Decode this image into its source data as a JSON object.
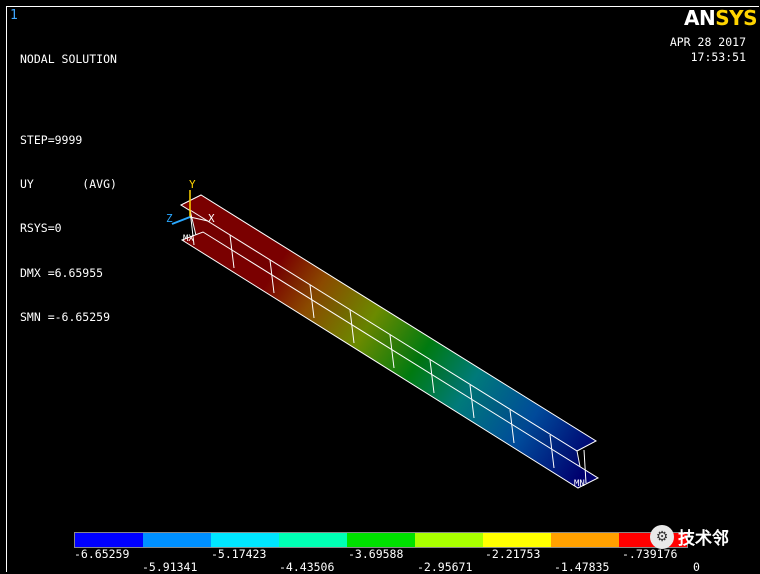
{
  "window_number": "1",
  "solution": {
    "title": "NODAL SOLUTION",
    "step": "STEP=9999",
    "item": "UY       (AVG)",
    "rsys": "RSYS=0",
    "dmx": "DMX =6.65955",
    "smn": "SMN =-6.65259"
  },
  "logo": {
    "part1": "AN",
    "part2": "SYS"
  },
  "timestamp": {
    "date": "APR 28 2017",
    "time": "17:53:51"
  },
  "triad": {
    "y": "Y",
    "z": "Z",
    "x": "X"
  },
  "markers": {
    "mx": "MX",
    "mn": "MN"
  },
  "legend": {
    "colors": [
      "#0000ff",
      "#0090ff",
      "#00e6ff",
      "#00ffb4",
      "#00e000",
      "#a8ff00",
      "#ffff00",
      "#ffa000",
      "#ff0000"
    ],
    "labels_top": [
      "-6.65259",
      "-5.17423",
      "-3.69588",
      "-2.21753",
      "-.739176"
    ],
    "labels_bottom": [
      "-5.91341",
      "-4.43506",
      "-2.95671",
      "-1.47835",
      "0"
    ]
  },
  "watermark": {
    "icon": "gear-icon",
    "text": "技术邻"
  }
}
